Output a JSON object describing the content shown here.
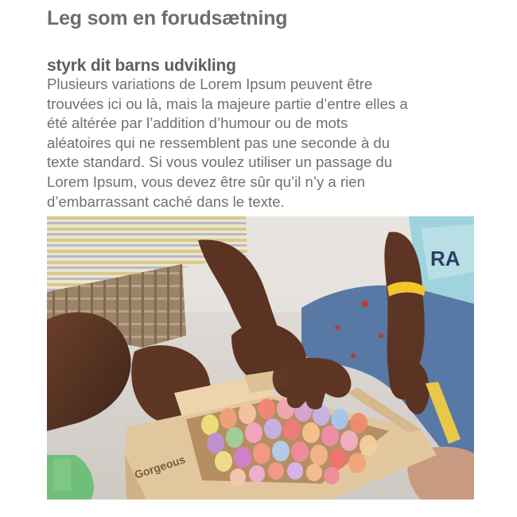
{
  "article": {
    "title": "Leg som en forudsætning",
    "subtitle": "styrk dit barns udvikling",
    "body_lines": [
      "Plusieurs variations de Lorem Ipsum peuvent être",
      "trouvées ici ou là, mais la majeure partie d’entre elles a",
      "été altérée par l’addition d’humour ou de mots",
      "aléatoires qui ne ressemblent pas une seconde à du",
      "texte standard. Si vous voulez utiliser un passage du",
      "Lorem Ipsum, vous devez être sûr qu’il n’y a rien",
      "d’embarrassant caché dans le texte."
    ]
  },
  "photo": {
    "chalk_box_text": "Gorgeous",
    "shirt_text": "RA",
    "colors": {
      "skin": "#5a3423",
      "box": "#e3c9a1",
      "shirt_stripes": "#d7c98c",
      "jeans": "#5a7aa8",
      "floor": "#d8d3ce"
    }
  }
}
